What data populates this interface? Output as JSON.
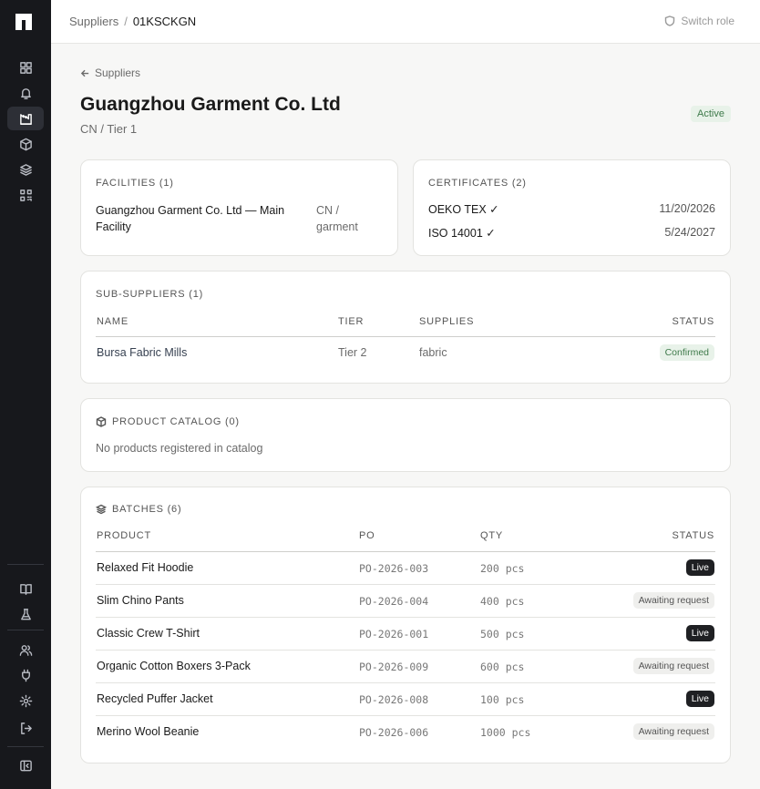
{
  "topbar": {
    "breadcrumb_parent": "Suppliers",
    "breadcrumb_sep": "/",
    "breadcrumb_current": "01KSCKGN",
    "switch_role": "Switch role"
  },
  "header": {
    "back_label": "Suppliers",
    "title": "Guangzhou Garment Co. Ltd",
    "subtitle": "CN / Tier 1",
    "status": "Active"
  },
  "facilities": {
    "heading": "FACILITIES (1)",
    "items": [
      {
        "name": "Guangzhou Garment Co. Ltd — Main Facility",
        "location": "CN / garment"
      }
    ]
  },
  "certificates": {
    "heading": "CERTIFICATES (2)",
    "items": [
      {
        "name": "OEKO TEX ✓",
        "date": "11/20/2026"
      },
      {
        "name": "ISO 14001 ✓",
        "date": "5/24/2027"
      }
    ]
  },
  "sub_suppliers": {
    "heading": "SUB-SUPPLIERS (1)",
    "columns": [
      "NAME",
      "TIER",
      "SUPPLIES",
      "STATUS"
    ],
    "rows": [
      {
        "name": "Bursa Fabric Mills",
        "tier": "Tier 2",
        "supplies": "fabric",
        "status": "Confirmed"
      }
    ]
  },
  "product_catalog": {
    "heading": "PRODUCT CATALOG (0)",
    "empty_text": "No products registered in catalog"
  },
  "batches": {
    "heading": "BATCHES (6)",
    "columns": [
      "PRODUCT",
      "PO",
      "QTY",
      "STATUS"
    ],
    "rows": [
      {
        "product": "Relaxed Fit Hoodie",
        "po": "PO-2026-003",
        "qty": "200 pcs",
        "status": "Live"
      },
      {
        "product": "Slim Chino Pants",
        "po": "PO-2026-004",
        "qty": "400 pcs",
        "status": "Awaiting request"
      },
      {
        "product": "Classic Crew T-Shirt",
        "po": "PO-2026-001",
        "qty": "500 pcs",
        "status": "Live"
      },
      {
        "product": "Organic Cotton Boxers 3-Pack",
        "po": "PO-2026-009",
        "qty": "600 pcs",
        "status": "Awaiting request"
      },
      {
        "product": "Recycled Puffer Jacket",
        "po": "PO-2026-008",
        "qty": "100 pcs",
        "status": "Live"
      },
      {
        "product": "Merino Wool Beanie",
        "po": "PO-2026-006",
        "qty": "1000 pcs",
        "status": "Awaiting request"
      }
    ]
  },
  "sidebar_icons": [
    "grid-icon",
    "bell-icon",
    "factory-icon",
    "box-icon",
    "layers-icon",
    "qr-code-icon",
    "book-icon",
    "flask-icon",
    "users-icon",
    "plug-icon",
    "gear-icon",
    "logout-icon",
    "collapse-sidebar-icon"
  ],
  "colors": {
    "sidebar": "#17181c",
    "active_badge": "#3e7a4a",
    "live_pill": "#1f2023"
  }
}
